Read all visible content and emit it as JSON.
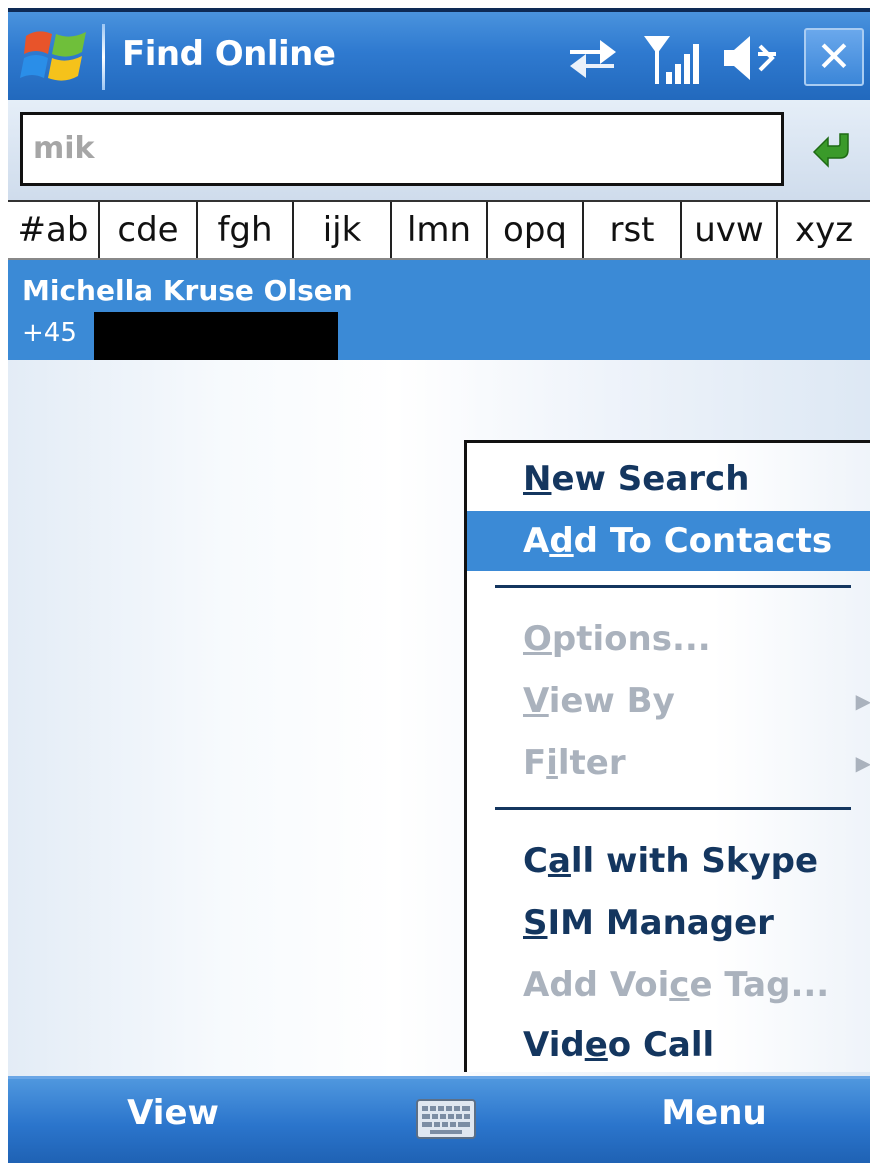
{
  "title_bar": {
    "title": "Find Online",
    "icons": [
      "windows-start-icon",
      "sync-icon",
      "signal-icon",
      "volume-icon",
      "close-icon"
    ],
    "close_label": "✕"
  },
  "search": {
    "value": "mik"
  },
  "alphabet_tabs": [
    "#ab",
    "cde",
    "fgh",
    "ijk",
    "lmn",
    "opq",
    "rst",
    "uvw",
    "xyz"
  ],
  "results": [
    {
      "name": "Michella Kruse Olsen",
      "phone_prefix": "+45",
      "phone_redacted": true
    }
  ],
  "menu": {
    "new_search": {
      "pre": "",
      "ul": "N",
      "post": "ew Search"
    },
    "add_to_contacts": {
      "pre": "A",
      "ul": "d",
      "post": "d To Contacts"
    },
    "options": {
      "pre": "",
      "ul": "O",
      "post": "ptions..."
    },
    "view_by": {
      "pre": "",
      "ul": "V",
      "post": "iew By"
    },
    "filter": {
      "pre": "F",
      "ul": "i",
      "post": "lter"
    },
    "call_with_skype": {
      "pre": "C",
      "ul": "a",
      "post": "ll with Skype"
    },
    "sim_manager": {
      "pre": "",
      "ul": "S",
      "post": "IM Manager"
    },
    "add_voice_tag": {
      "pre": "Add Voi",
      "ul": "c",
      "post": "e Tag..."
    },
    "video_call": {
      "pre": "Vid",
      "ul": "e",
      "post": "o Call"
    },
    "submenu_arrow": "▶"
  },
  "softkeys": {
    "left": "View",
    "right": "Menu"
  },
  "colors": {
    "titlebar": "#2f7ad0",
    "selection": "#3b8ad6",
    "menu_text": "#14365f",
    "disabled_text": "#aab2bd"
  }
}
